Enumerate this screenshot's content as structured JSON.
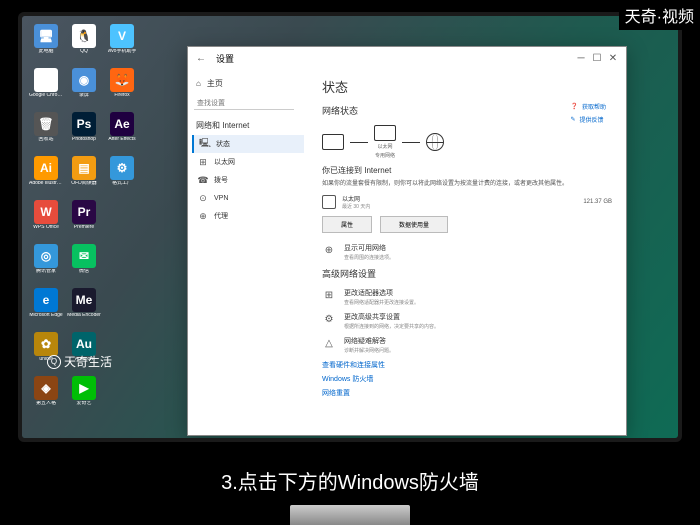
{
  "watermarks": {
    "top_right": "天奇·视频",
    "bottom_left": "天奇生活"
  },
  "caption": "3.点击下方的Windows防火墙",
  "desktop_icons": [
    {
      "label": "此电脑",
      "bg": "#4a90d9",
      "char": "🖥"
    },
    {
      "label": "Google Chrome",
      "bg": "#fff",
      "char": "◉"
    },
    {
      "label": "回收站",
      "bg": "#555",
      "char": "🗑"
    },
    {
      "label": "Adobe Illustrator",
      "bg": "#ff9a00",
      "char": "Ai"
    },
    {
      "label": "WPS Office",
      "bg": "#e74c3c",
      "char": "W"
    },
    {
      "label": "腾讯管家",
      "bg": "#3498db",
      "char": "◎"
    },
    {
      "label": "Microsoft Edge",
      "bg": "#0078d4",
      "char": "e"
    },
    {
      "label": "unicef",
      "bg": "#b8860b",
      "char": "✿"
    },
    {
      "label": "第五人格",
      "bg": "#8b4513",
      "char": "◈"
    },
    {
      "label": "QQ",
      "bg": "#fff",
      "char": "🐧"
    },
    {
      "label": "录屏",
      "bg": "#4a90d9",
      "char": "◉"
    },
    {
      "label": "Photoshop",
      "bg": "#001e36",
      "char": "Ps"
    },
    {
      "label": "OFD阅读器",
      "bg": "#f39c12",
      "char": "▤"
    },
    {
      "label": "Premiere",
      "bg": "#2a0845",
      "char": "Pr"
    },
    {
      "label": "微信",
      "bg": "#07c160",
      "char": "✉"
    },
    {
      "label": "Media Encoder",
      "bg": "#1a1a2e",
      "char": "Me"
    },
    {
      "label": "Audition",
      "bg": "#00646a",
      "char": "Au"
    },
    {
      "label": "爱奇艺",
      "bg": "#00be06",
      "char": "▶"
    },
    {
      "label": "vivo手机助手",
      "bg": "#4dc3ff",
      "char": "V"
    },
    {
      "label": "Firefox",
      "bg": "#ff6611",
      "char": "🦊"
    },
    {
      "label": "After Effects",
      "bg": "#1f0040",
      "char": "Ae"
    },
    {
      "label": "格式工厂",
      "bg": "#3498db",
      "char": "⚙"
    }
  ],
  "settings": {
    "back": "←",
    "home": "主页",
    "search_placeholder": "查找设置",
    "category": "网络和 Internet",
    "nav": [
      {
        "icon": "🖳",
        "label": "状态",
        "active": true
      },
      {
        "icon": "⊞",
        "label": "以太网"
      },
      {
        "icon": "☎",
        "label": "拨号"
      },
      {
        "icon": "⊙",
        "label": "VPN"
      },
      {
        "icon": "⊕",
        "label": "代理"
      }
    ],
    "title": "状态",
    "section_network": "网络状态",
    "diagram": {
      "device": "以太网",
      "type": "专用网络"
    },
    "connected_title": "你已连接到 Internet",
    "connected_desc": "如果你的流量套餐有限制，则你可以将此网络设置为按流量计费的连接，或者更改其他属性。",
    "usage": {
      "name": "以太网",
      "sub": "最近 30 天内",
      "value": "121.37 GB"
    },
    "buttons": {
      "props": "属性",
      "data": "数据使用量"
    },
    "section_advanced": "高级网络设置",
    "items": [
      {
        "icon": "⊞",
        "title": "更改适配器选项",
        "sub": "查看网络适配器并更改连接设置。"
      },
      {
        "icon": "⚙",
        "title": "更改高级共享设置",
        "sub": "根据所连接到的网络，决定要共享的内容。"
      },
      {
        "icon": "△",
        "title": "网络疑难解答",
        "sub": "诊断并解决网络问题。"
      }
    ],
    "links": [
      "查看硬件和连接属性",
      "Windows 防火墙",
      "网络重置"
    ],
    "help": {
      "get_help": "获取帮助",
      "feedback": "提供反馈"
    }
  }
}
